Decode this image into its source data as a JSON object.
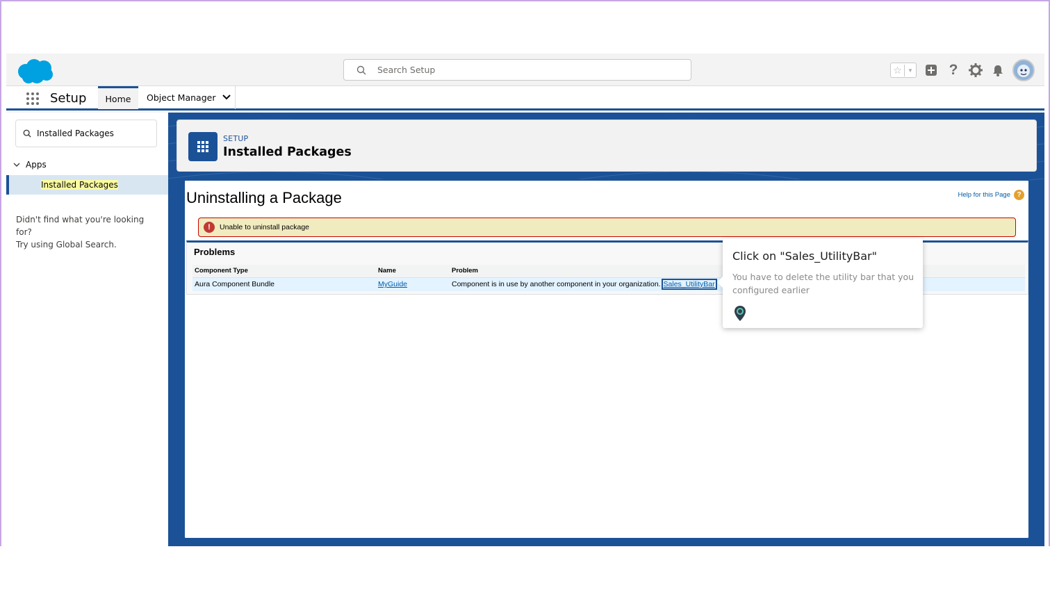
{
  "header": {
    "search_placeholder": "Search Setup",
    "icons": [
      "favorites-star-icon",
      "favorites-caret-icon",
      "global-actions-icon",
      "help-icon",
      "setup-gear-icon",
      "notifications-bell-icon",
      "user-avatar"
    ]
  },
  "context_bar": {
    "app_name": "Setup",
    "tabs": [
      {
        "label": "Home",
        "active": true
      },
      {
        "label": "Object Manager",
        "active": false
      }
    ]
  },
  "sidebar": {
    "search_value": "Installed Packages",
    "group": "Apps",
    "active_item": "Installed Packages",
    "help_line1": "Didn't find what you're looking for?",
    "help_line2": "Try using Global Search."
  },
  "page_header": {
    "eyebrow": "SETUP",
    "title": "Installed Packages"
  },
  "content": {
    "title": "Uninstalling a Package",
    "help_link": "Help for this Page",
    "error_message": "Unable to uninstall package",
    "section_title": "Problems",
    "table": {
      "headers": [
        "Component Type",
        "Name",
        "Problem"
      ],
      "rows": [
        {
          "type": "Aura Component Bundle",
          "name": "MyGuide",
          "problem": "Component is in use by another component in your organization.",
          "link": "Sales_UtilityBar"
        }
      ]
    }
  },
  "tooltip": {
    "title": "Click on \"Sales_UtilityBar\"",
    "body": "You have to delete the utility bar that you configured earlier"
  },
  "colors": {
    "brand_blue": "#1b5297",
    "error_red": "#c23934",
    "highlight_yellow": "#fafca0"
  }
}
